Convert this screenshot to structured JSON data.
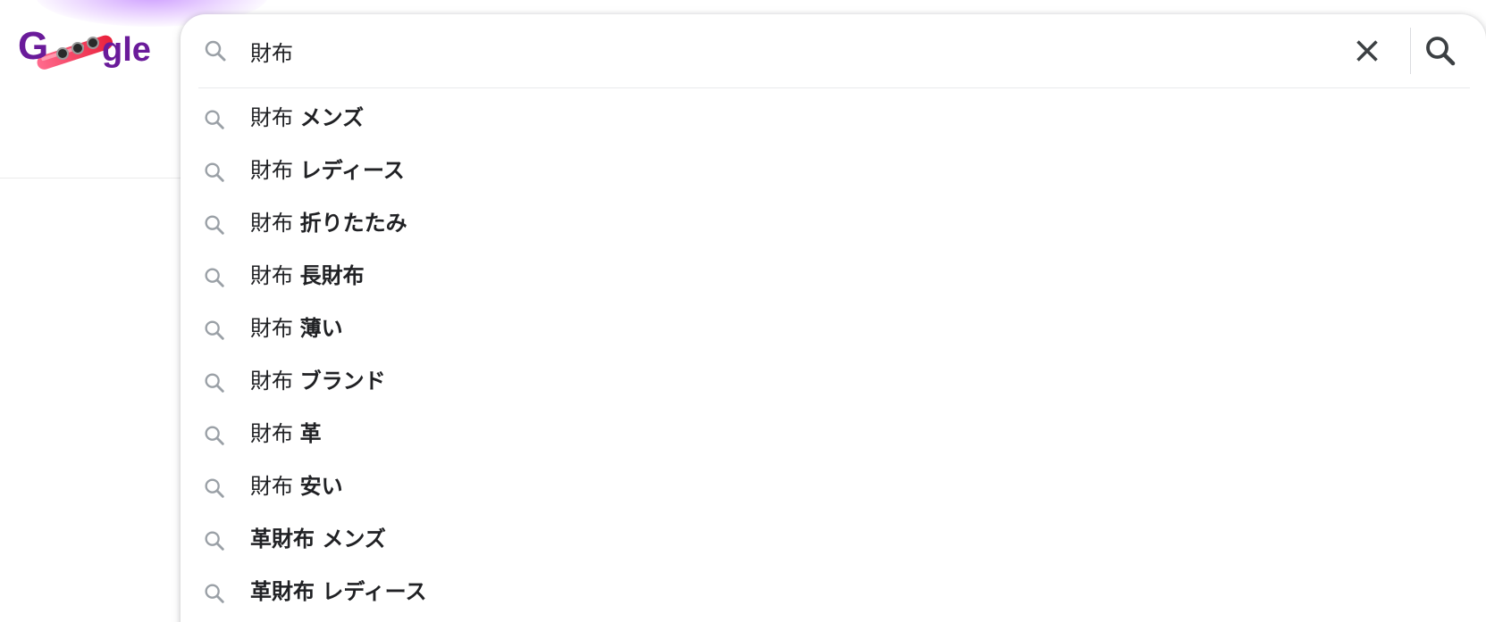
{
  "logo": {
    "text": "Google",
    "colors": {
      "purple": "#6a1b9a",
      "pink": "#e84a7f",
      "red": "#ef3b3b"
    }
  },
  "search": {
    "query": "財布",
    "clear_icon": "close-icon",
    "submit_icon": "search-icon"
  },
  "suggestions": [
    {
      "prefix": "財布",
      "completion": "メンズ"
    },
    {
      "prefix": "財布",
      "completion": "レディース"
    },
    {
      "prefix": "財布",
      "completion": "折りたたみ"
    },
    {
      "prefix": "財布",
      "completion": "長財布"
    },
    {
      "prefix": "財布",
      "completion": "薄い"
    },
    {
      "prefix": "財布",
      "completion": "ブランド"
    },
    {
      "prefix": "財布",
      "completion": "革"
    },
    {
      "prefix": "財布",
      "completion": "安い"
    },
    {
      "prefix": "",
      "completion": "革財布 メンズ"
    },
    {
      "prefix": "",
      "completion": "革財布 レディース"
    }
  ]
}
